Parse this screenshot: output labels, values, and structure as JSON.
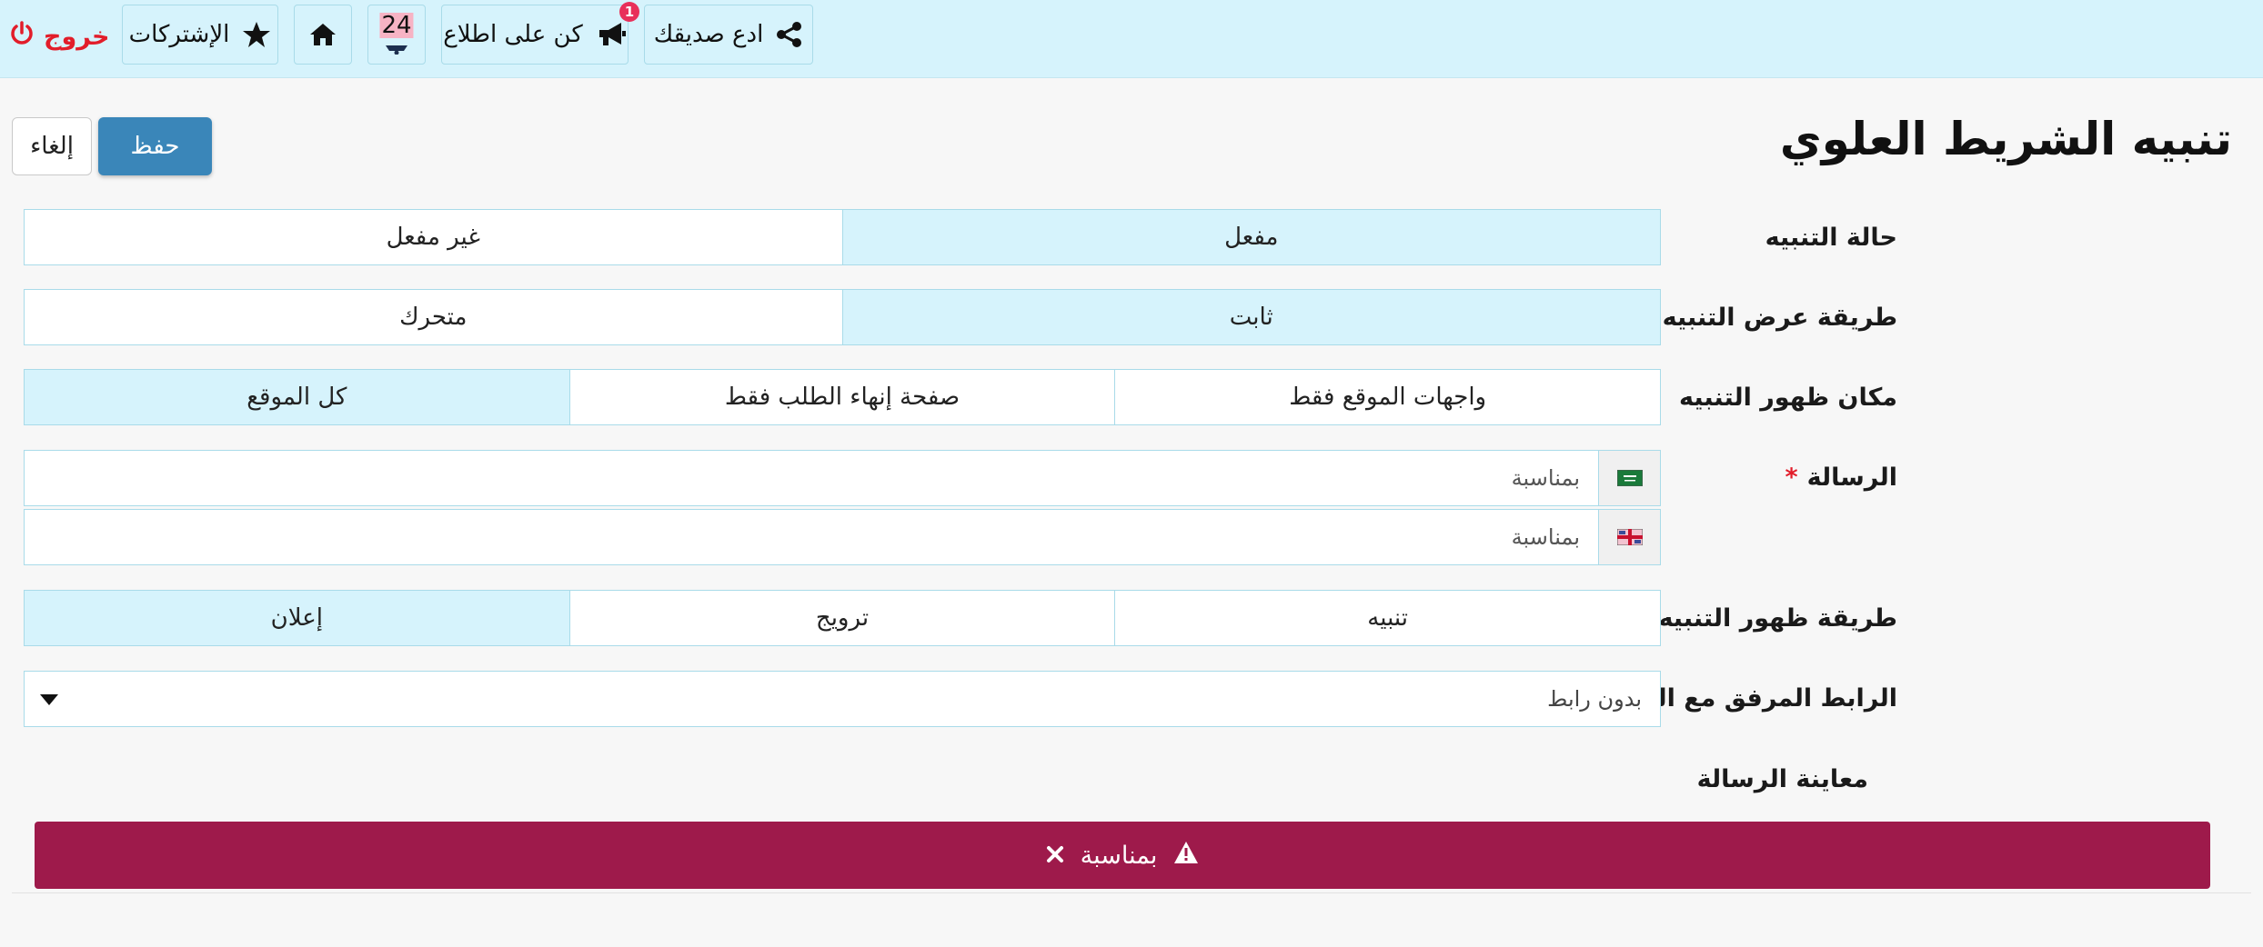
{
  "topbar": {
    "invite_label": "ادع صديقك",
    "stay_informed_label": "كن على اطلاع",
    "stay_informed_badge": "1",
    "notifications_count": "24",
    "subscriptions_label": "الإشتركات",
    "logout_label": "خروج"
  },
  "header": {
    "title": "تنبيه الشريط العلوي",
    "save_label": "حفظ",
    "cancel_label": "إلغاء"
  },
  "form": {
    "status": {
      "label": "حالة التنبيه",
      "options": [
        "مفعل",
        "غير مفعل"
      ],
      "selected": "مفعل"
    },
    "display_method": {
      "label": "طريقة عرض التنبيه",
      "options": [
        "ثابت",
        "متحرك"
      ],
      "selected": "ثابت"
    },
    "placement": {
      "label": "مكان ظهور التنبيه",
      "options": [
        "واجهات الموقع فقط",
        "صفحة إنهاء الطلب فقط",
        "كل الموقع"
      ],
      "selected": "كل الموقع"
    },
    "message": {
      "label": "الرسالة",
      "required_mark": "*",
      "arabic_value": "بمناسبة",
      "english_value": "بمناسبة"
    },
    "appearance": {
      "label": "طريقة ظهور التنبيه",
      "options": [
        "تنبيه",
        "ترويج",
        "إعلان"
      ],
      "selected": "إعلان"
    },
    "link": {
      "label": "الرابط المرفق مع التنبيه",
      "selected": "بدون رابط"
    },
    "preview": {
      "label": "معاينة الرسالة",
      "text": "بمناسبة"
    }
  },
  "colors": {
    "topbar_bg": "#d6f3fc",
    "primary_button": "#3a86b9",
    "preview_bar": "#9e1a4b",
    "logout": "#e21d2a"
  }
}
